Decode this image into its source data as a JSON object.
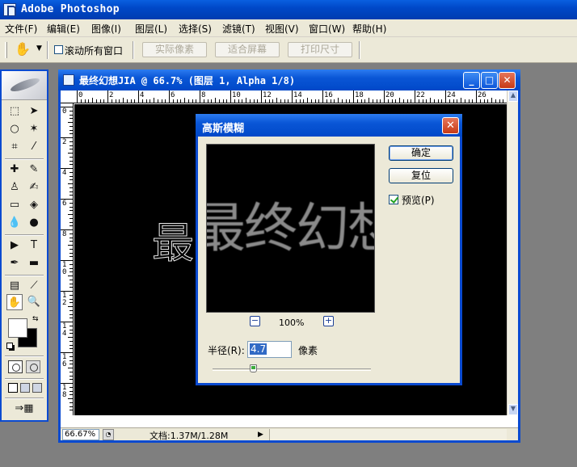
{
  "app": {
    "title": "Adobe Photoshop"
  },
  "menu": [
    {
      "label": "文件(F)"
    },
    {
      "label": "编辑(E)"
    },
    {
      "label": "图像(I)"
    },
    {
      "label": "图层(L)"
    },
    {
      "label": "选择(S)"
    },
    {
      "label": "滤镜(T)"
    },
    {
      "label": "视图(V)"
    },
    {
      "label": "窗口(W)"
    },
    {
      "label": "帮助(H)"
    }
  ],
  "options_bar": {
    "scroll_all_windows": "滚动所有窗口",
    "actual_pixels": "实际像素",
    "fit_screen": "适合屏幕",
    "print_size": "打印尺寸"
  },
  "document": {
    "title": "最终幻想JIA @ 66.7% (图层 1, Alpha 1/8)",
    "ruler_top": [
      "0",
      "2",
      "4",
      "6",
      "8",
      "10",
      "12",
      "14",
      "16",
      "18",
      "20",
      "22",
      "24",
      "26"
    ],
    "ruler_left": [
      "0",
      "2",
      "4",
      "6",
      "8",
      "10",
      "12",
      "14",
      "16",
      "18"
    ],
    "canvas_text": "最",
    "zoom": "66.67%",
    "doc_size": "文档:1.37M/1.28M"
  },
  "dialog": {
    "title": "高斯模糊",
    "preview_text": "最终幻想",
    "zoom_level": "100%",
    "ok": "确定",
    "reset": "复位",
    "preview_label": "预览(P)",
    "preview_checked": true,
    "radius_label": "半径(R):",
    "radius_value": "4.7",
    "radius_unit": "像素"
  },
  "colors": {
    "foreground": "#ffffff",
    "background": "#000000",
    "title_blue": "#0a4ad0"
  }
}
